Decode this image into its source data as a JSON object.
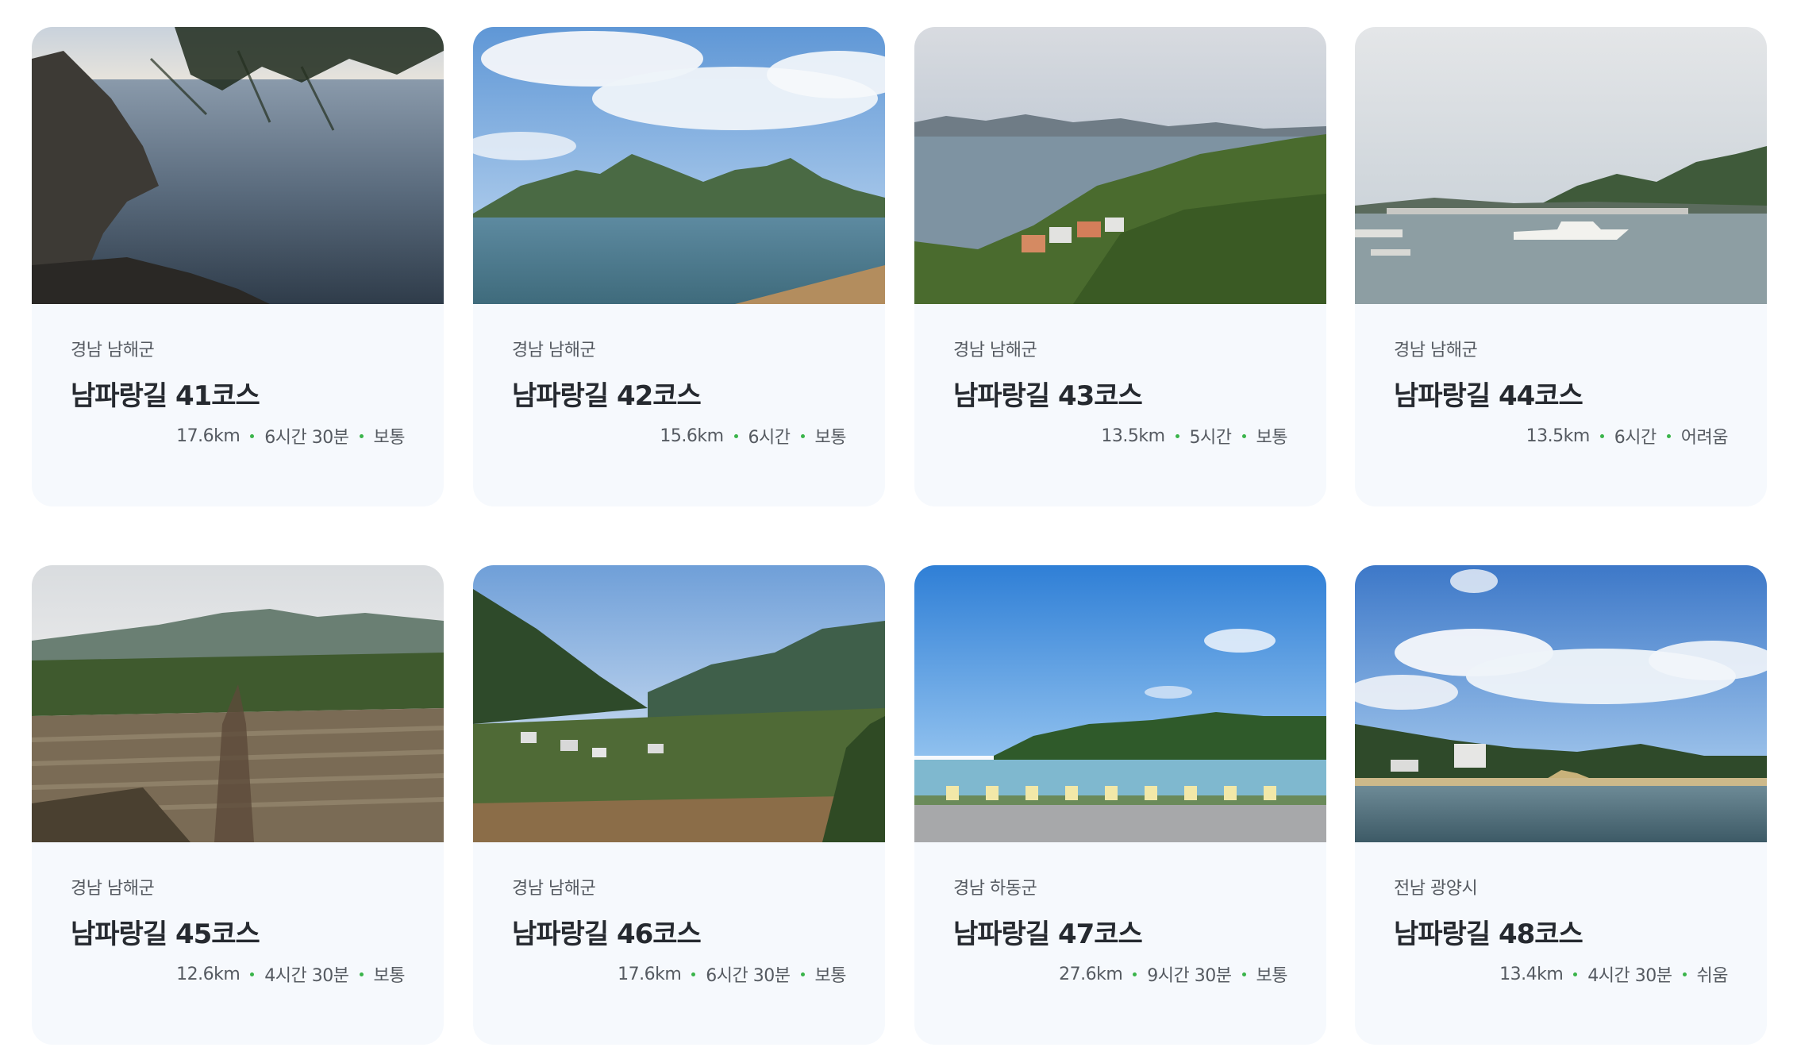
{
  "accent_dot_color": "#3ab44a",
  "courses": [
    {
      "region": "경남 남해군",
      "title": "남파랑길 41코스",
      "distance": "17.6km",
      "duration": "6시간 30분",
      "difficulty": "보통",
      "image": "rocky-coast-sea-photo"
    },
    {
      "region": "경남 남해군",
      "title": "남파랑길 42코스",
      "distance": "15.6km",
      "duration": "6시간",
      "difficulty": "보통",
      "image": "island-mountain-sea-photo"
    },
    {
      "region": "경남 남해군",
      "title": "남파랑길 43코스",
      "distance": "13.5km",
      "duration": "5시간",
      "difficulty": "보통",
      "image": "hillside-village-coast-photo"
    },
    {
      "region": "경남 남해군",
      "title": "남파랑길 44코스",
      "distance": "13.5km",
      "duration": "6시간",
      "difficulty": "어려움",
      "image": "harbor-boats-photo"
    },
    {
      "region": "경남 남해군",
      "title": "남파랑길 45코스",
      "distance": "12.6km",
      "duration": "4시간 30분",
      "difficulty": "보통",
      "image": "terraced-fields-photo"
    },
    {
      "region": "경남 남해군",
      "title": "남파랑길 46코스",
      "distance": "17.6km",
      "duration": "6시간 30분",
      "difficulty": "보통",
      "image": "mountain-valley-village-photo"
    },
    {
      "region": "경남 하동군",
      "title": "남파랑길 47코스",
      "distance": "27.6km",
      "duration": "9시간 30분",
      "difficulty": "보통",
      "image": "seaside-road-blue-sky-photo"
    },
    {
      "region": "전남 광양시",
      "title": "남파랑길 48코스",
      "distance": "13.4km",
      "duration": "4시간 30분",
      "difficulty": "쉬움",
      "image": "lake-beach-clouds-photo"
    }
  ]
}
